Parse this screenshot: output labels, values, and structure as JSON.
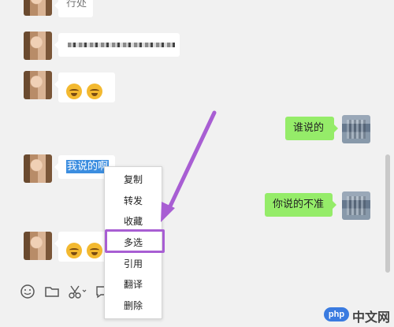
{
  "messages": {
    "m1_partial": "行处",
    "m6_sent": "谁说的",
    "m7_selected_text": "我说的啊",
    "m8_sent": "你说的不准"
  },
  "context_menu": {
    "items": [
      "复制",
      "转发",
      "收藏",
      "多选",
      "引用",
      "翻译",
      "删除"
    ],
    "highlighted": "多选"
  },
  "toolbar": {
    "icons": [
      "emoji-icon",
      "folder-icon",
      "scissors-icon",
      "chat-history-icon"
    ]
  },
  "colors": {
    "sent_bubble": "#95ec69",
    "received_bubble": "#ffffff",
    "selection": "#3c8ee0",
    "annotation": "#a85ed3"
  },
  "watermark": {
    "badge": "php",
    "text": "中文网"
  }
}
